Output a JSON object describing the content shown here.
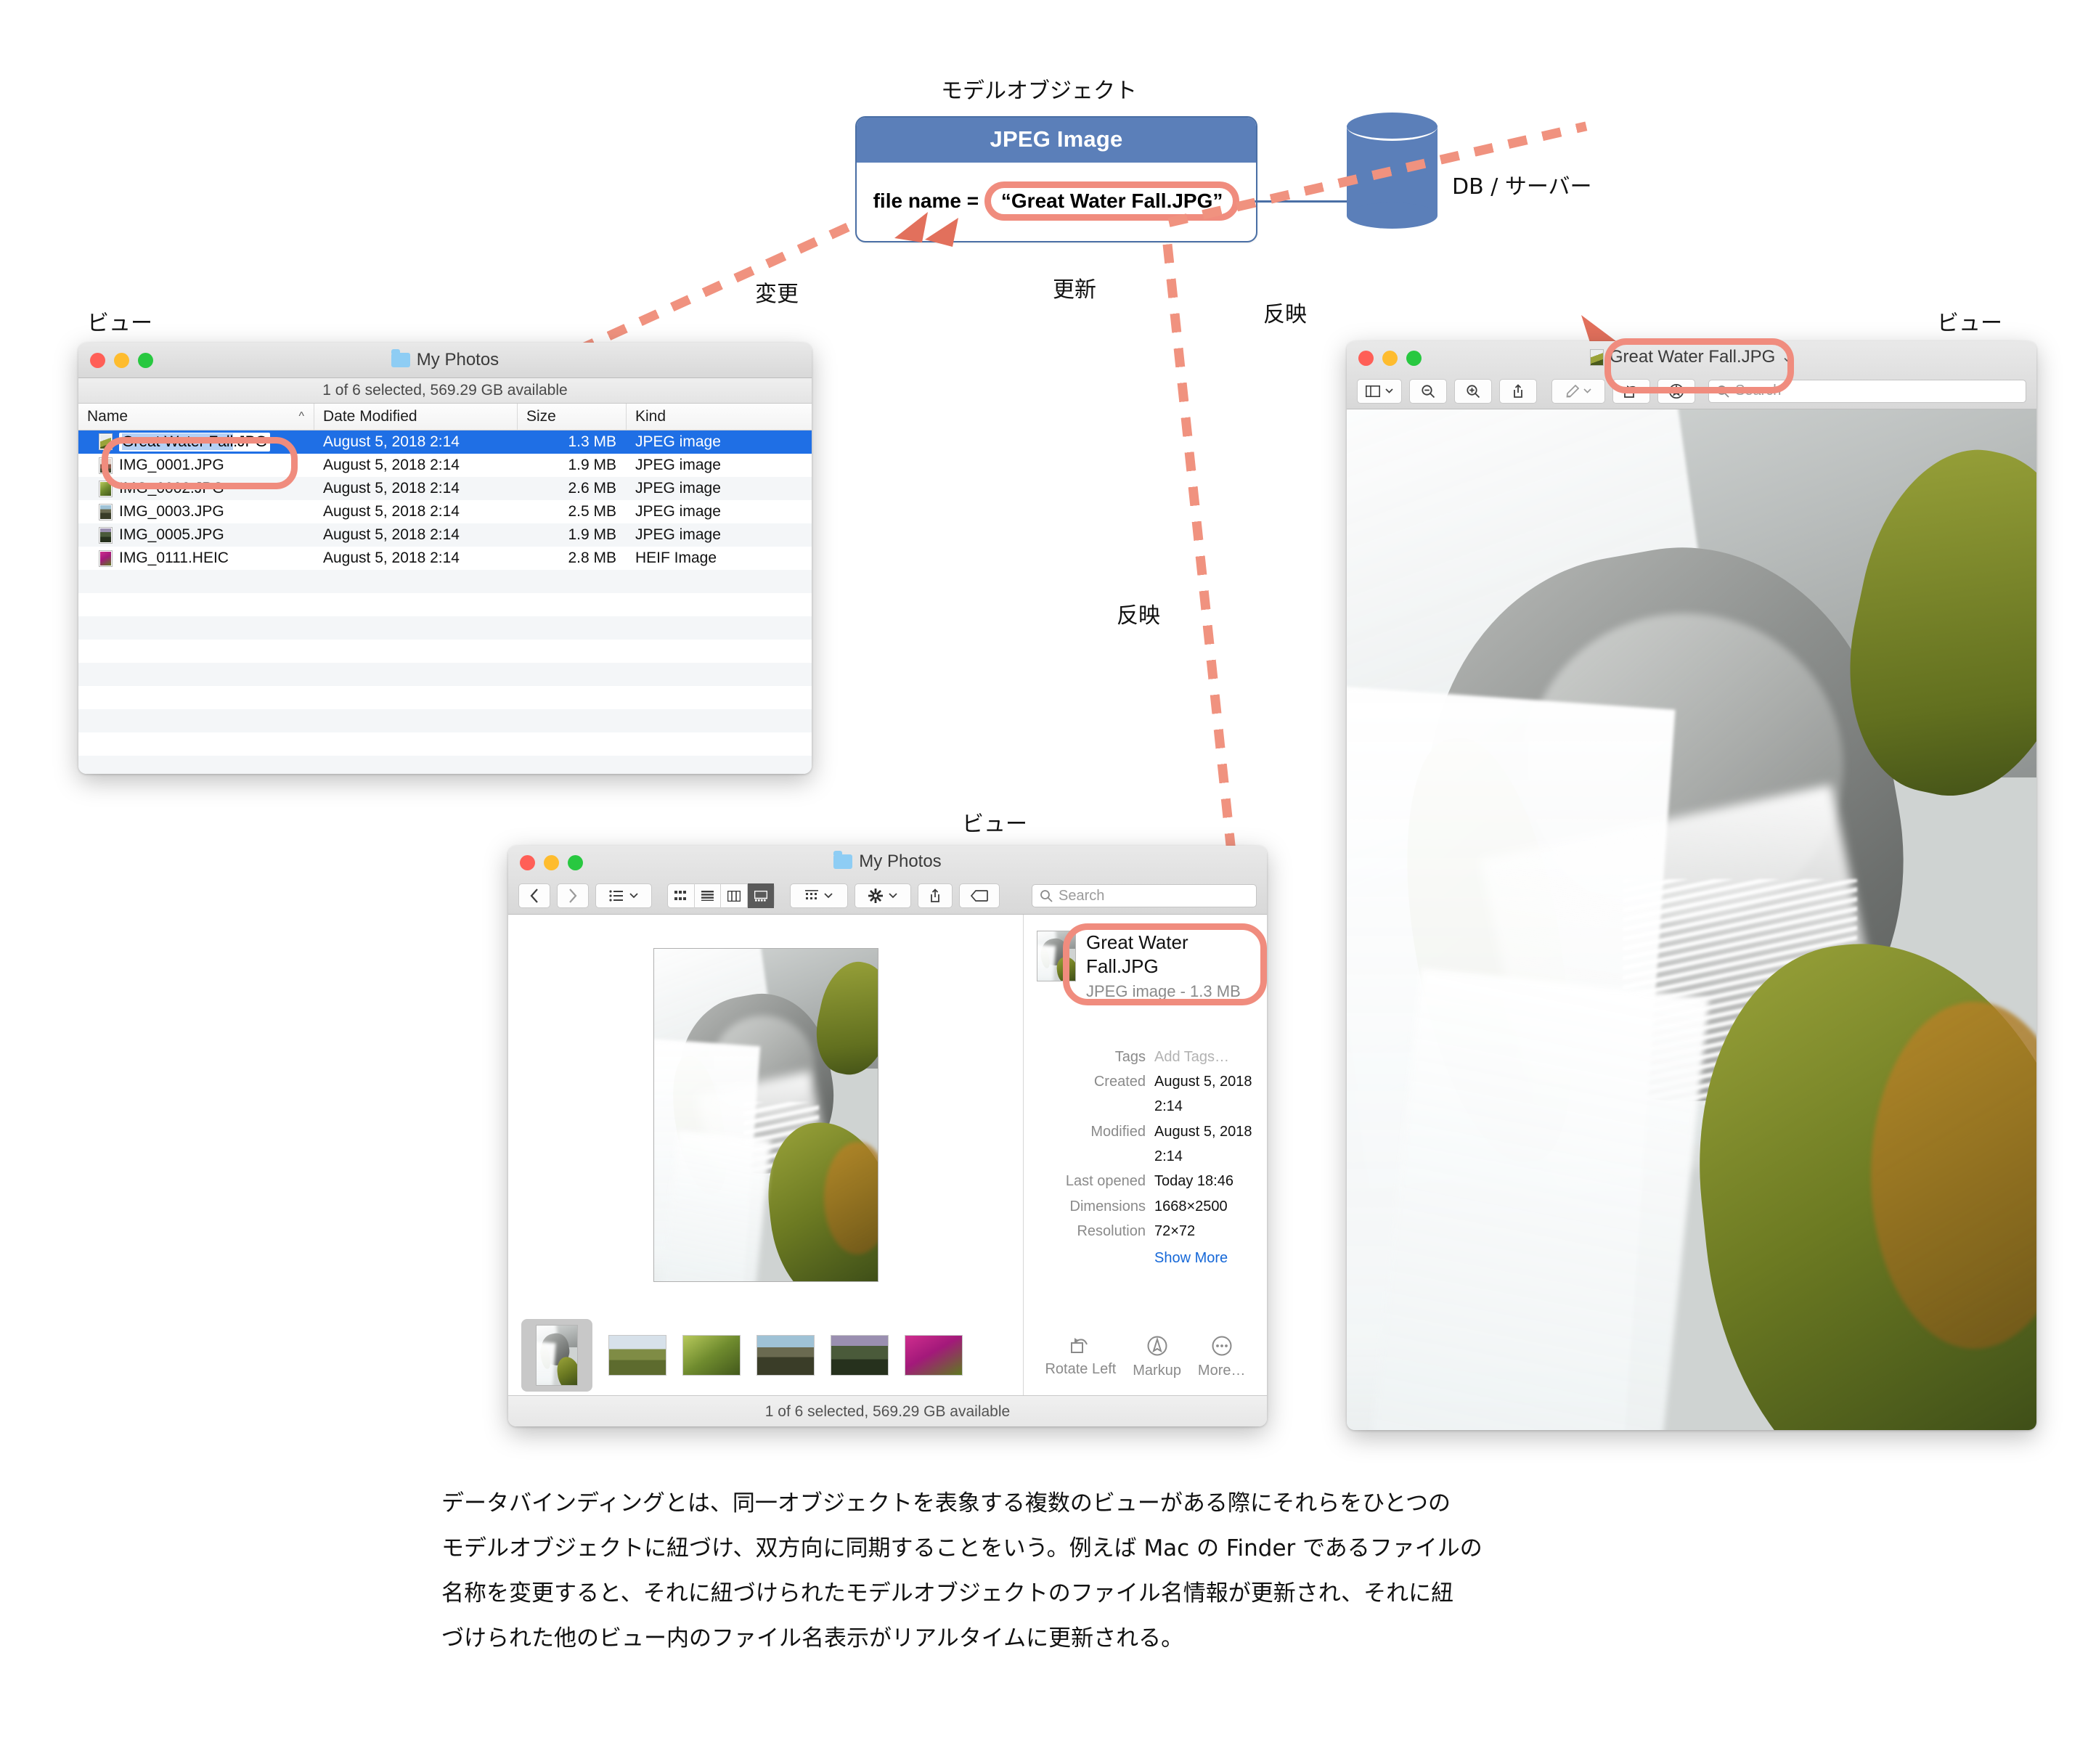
{
  "diagram": {
    "model_title": "モデルオブジェクト",
    "model_box": {
      "header": "JPEG Image",
      "field_prefix": "file name = ",
      "field_value": "“Great Water Fall.JPG”"
    },
    "db_label": "DB / サーバー",
    "arrow_labels": {
      "change": "変更",
      "update": "更新",
      "reflect_right": "反映",
      "reflect_down": "反映"
    },
    "view_labels": {
      "left": "ビュー",
      "right": "ビュー",
      "bottom": "ビュー"
    },
    "accent_red": "#F08C7E",
    "accent_blue": "#5B7FB9"
  },
  "list_window": {
    "title": "My Photos",
    "status": "1 of 6 selected, 569.29 GB available",
    "columns": [
      "Name",
      "Date Modified",
      "Size",
      "Kind"
    ],
    "sort_indicator": "^",
    "rows": [
      {
        "name": "Great Water Fall.JPG",
        "name_stem": "Great Water Fall",
        "name_ext": ".JPG",
        "date": "August 5, 2018 2:14",
        "size": "1.3 MB",
        "kind": "JPEG image",
        "selected": true
      },
      {
        "name": "IMG_0001.JPG",
        "date": "August 5, 2018 2:14",
        "size": "1.9 MB",
        "kind": "JPEG image",
        "selected": false
      },
      {
        "name": "IMG_0002.JPG",
        "date": "August 5, 2018 2:14",
        "size": "2.6 MB",
        "kind": "JPEG image",
        "selected": false
      },
      {
        "name": "IMG_0003.JPG",
        "date": "August 5, 2018 2:14",
        "size": "2.5 MB",
        "kind": "JPEG image",
        "selected": false
      },
      {
        "name": "IMG_0005.JPG",
        "date": "August 5, 2018 2:14",
        "size": "1.9 MB",
        "kind": "JPEG image",
        "selected": false
      },
      {
        "name": "IMG_0111.HEIC",
        "date": "August 5, 2018 2:14",
        "size": "2.8 MB",
        "kind": "HEIF Image",
        "selected": false
      }
    ]
  },
  "gallery_window": {
    "title": "My Photos",
    "search_placeholder": "Search",
    "footer": "1 of 6 selected, 569.29 GB available",
    "info": {
      "name": "Great Water Fall.JPG",
      "subtitle": "JPEG image - 1.3 MB",
      "fields": [
        {
          "label": "Tags",
          "value": "Add Tags…",
          "placeholder": true
        },
        {
          "label": "Created",
          "value": "August 5, 2018 2:14",
          "placeholder": false
        },
        {
          "label": "Modified",
          "value": "August 5, 2018 2:14",
          "placeholder": false
        },
        {
          "label": "Last opened",
          "value": "Today 18:46",
          "placeholder": false
        },
        {
          "label": "Dimensions",
          "value": "1668×2500",
          "placeholder": false
        },
        {
          "label": "Resolution",
          "value": "72×72",
          "placeholder": false
        }
      ],
      "show_more": "Show More"
    },
    "actions": [
      {
        "label": "Rotate Left",
        "icon": "rotate-left-icon"
      },
      {
        "label": "Markup",
        "icon": "markup-icon"
      },
      {
        "label": "More…",
        "icon": "more-icon"
      }
    ],
    "toolbar_icons": [
      "back-icon",
      "forward-icon",
      "group-by-icon",
      "chevron-down-icon",
      "icon-view-icon",
      "list-view-icon",
      "column-view-icon",
      "gallery-view-icon",
      "arrange-icon",
      "chevron-down-icon",
      "action-gear-icon",
      "chevron-down-icon",
      "share-icon",
      "tag-icon",
      "search-icon"
    ]
  },
  "preview_window": {
    "title": "Great Water Fall.JPG",
    "title_chevron": "⌄",
    "search_placeholder": "Search",
    "toolbar_icons": [
      "sidebar-icon",
      "chevron-down-icon",
      "zoom-out-icon",
      "zoom-in-icon",
      "share-icon",
      "markup-pen-icon",
      "chevron-down-icon",
      "rotate-icon",
      "annotate-icon",
      "search-icon"
    ]
  },
  "caption": {
    "lines": [
      "データバインディングとは、同一オブジェクトを表象する複数のビューがある際にそれらをひとつの",
      "モデルオブジェクトに紐づけ、双方向に同期することをいう。例えば Mac の Finder であるファイルの",
      "名称を変更すると、それに紐づけられたモデルオブジェクトのファイル名情報が更新され、それに紐",
      "づけられた他のビュー内のファイル名表示がリアルタイムに更新される。"
    ]
  }
}
